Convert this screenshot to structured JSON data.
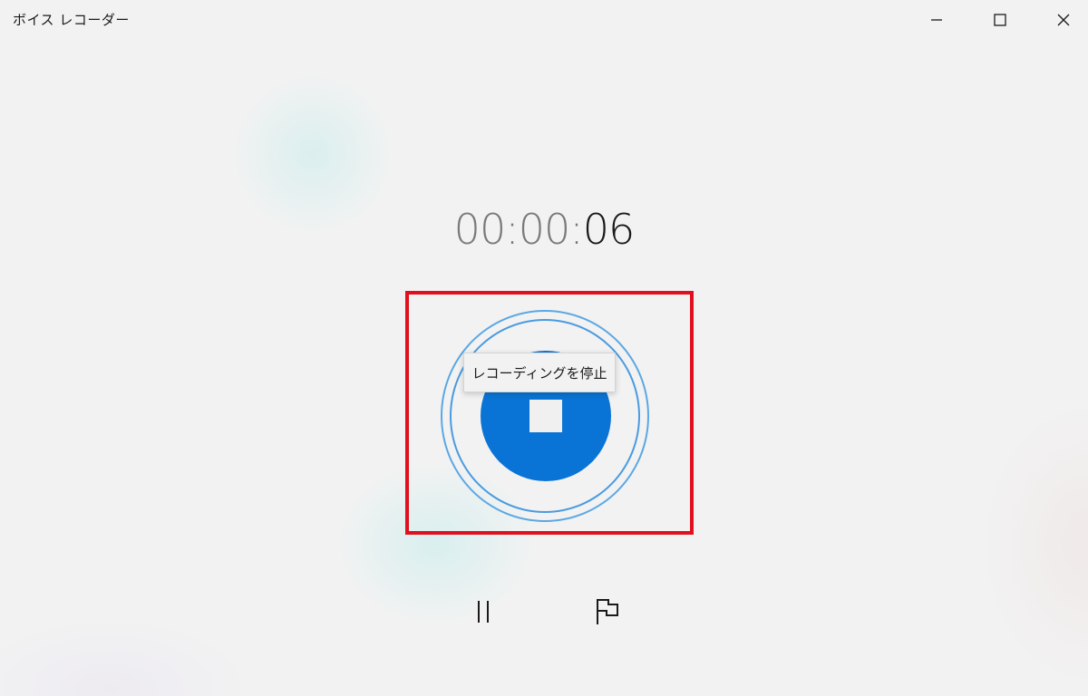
{
  "window": {
    "title": "ボイス レコーダー",
    "controls": {
      "minimize_icon": "minimize-icon",
      "maximize_icon": "maximize-icon",
      "close_icon": "close-icon"
    }
  },
  "recording": {
    "timer": {
      "hours": "00",
      "minutes": "00",
      "seconds": "06",
      "separator": ":"
    },
    "stop_button": {
      "tooltip": "レコーディングを停止",
      "icon": "stop-icon",
      "color": "#0a74d6"
    },
    "highlight_color": "#e0101e"
  },
  "bottom_controls": {
    "pause_icon": "pause-icon",
    "marker_icon": "flag-icon"
  }
}
